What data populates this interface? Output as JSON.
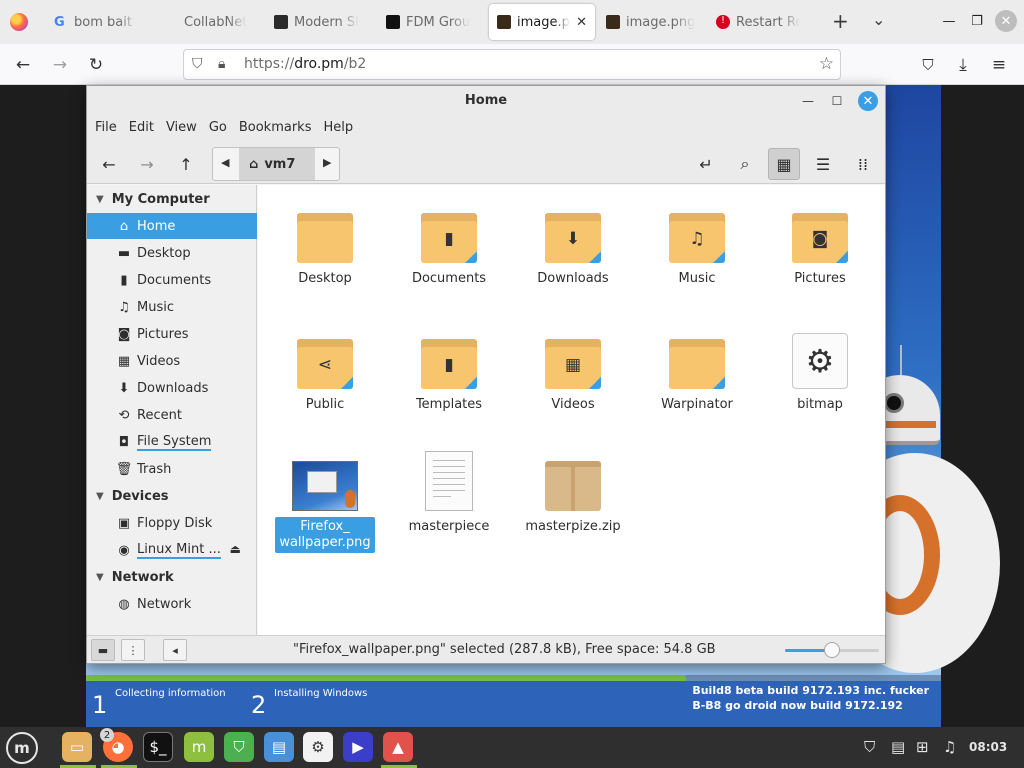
{
  "browser": {
    "tabs": [
      {
        "title": "bom bait -",
        "favicon": "google-g",
        "fav_color": "#4285f4",
        "active": false
      },
      {
        "title": "CollabNet",
        "favicon": "none",
        "fav_color": "",
        "active": false
      },
      {
        "title": "Modern Sl",
        "favicon": "site-icon",
        "fav_color": "#2b2b2b",
        "active": false
      },
      {
        "title": "FDM Grou",
        "favicon": "tiktok-icon",
        "fav_color": "#111111",
        "active": false
      },
      {
        "title": "image.pr",
        "favicon": "image-icon",
        "fav_color": "#3a2a1a",
        "active": true
      },
      {
        "title": "image.png",
        "favicon": "image-icon",
        "fav_color": "#3a2a1a",
        "active": false
      },
      {
        "title": "Restart Re",
        "favicon": "alert-icon",
        "fav_color": "#d70022",
        "active": false
      }
    ],
    "url": {
      "proto": "https://",
      "host": "dro.pm",
      "path": "/b2"
    }
  },
  "file_manager": {
    "title": "Home",
    "menu": [
      "File",
      "Edit",
      "View",
      "Go",
      "Bookmarks",
      "Help"
    ],
    "path_crumb": "vm7",
    "sidebar": {
      "my_computer": "My Computer",
      "items": [
        {
          "label": "Home",
          "icon": "home-icon",
          "glyph": "⌂"
        },
        {
          "label": "Desktop",
          "icon": "desktop-icon",
          "glyph": "▬"
        },
        {
          "label": "Documents",
          "icon": "document-icon",
          "glyph": "▮"
        },
        {
          "label": "Music",
          "icon": "music-icon",
          "glyph": "♫"
        },
        {
          "label": "Pictures",
          "icon": "camera-icon",
          "glyph": "◙"
        },
        {
          "label": "Videos",
          "icon": "film-icon",
          "glyph": "▦"
        },
        {
          "label": "Downloads",
          "icon": "download-icon",
          "glyph": "⬇"
        },
        {
          "label": "Recent",
          "icon": "recent-icon",
          "glyph": "⟲"
        },
        {
          "label": "File System",
          "icon": "drive-icon",
          "glyph": "◘"
        },
        {
          "label": "Trash",
          "icon": "trash-icon",
          "glyph": "🗑"
        }
      ],
      "devices": "Devices",
      "device_items": [
        {
          "label": "Floppy Disk",
          "icon": "floppy-icon",
          "glyph": "▣"
        },
        {
          "label": "Linux Mint ...",
          "icon": "disc-icon",
          "glyph": "◉"
        }
      ],
      "network": "Network",
      "network_items": [
        {
          "label": "Network",
          "icon": "globe-icon",
          "glyph": "◍"
        }
      ]
    },
    "files": [
      {
        "name": "Desktop",
        "kind": "folder",
        "symbol": ""
      },
      {
        "name": "Documents",
        "kind": "folder",
        "symbol": "▮"
      },
      {
        "name": "Downloads",
        "kind": "folder",
        "symbol": "⬇"
      },
      {
        "name": "Music",
        "kind": "folder",
        "symbol": "♫"
      },
      {
        "name": "Pictures",
        "kind": "folder",
        "symbol": "◙"
      },
      {
        "name": "Public",
        "kind": "folder",
        "symbol": "⋖"
      },
      {
        "name": "Templates",
        "kind": "folder",
        "symbol": "▮"
      },
      {
        "name": "Videos",
        "kind": "folder",
        "symbol": "▦"
      },
      {
        "name": "Warpinator",
        "kind": "folder",
        "symbol": ""
      },
      {
        "name": "bitmap",
        "kind": "executable",
        "symbol": "⚙"
      },
      {
        "name": "Firefox_\nwallpaper.png",
        "kind": "image",
        "symbol": ""
      },
      {
        "name": "masterpiece",
        "kind": "document",
        "symbol": ""
      },
      {
        "name": "masterpize.zip",
        "kind": "archive",
        "symbol": ""
      }
    ],
    "status": "\"Firefox_wallpaper.png\" selected (287.8 kB), Free space: 54.8 GB",
    "zoom_level": 0.5
  },
  "installer": {
    "step1_num": "1",
    "step1_label": "Collecting information",
    "step2_num": "2",
    "step2_label": "Installing Windows",
    "build_line1": "Build8 beta build 9172.193 inc. fucker",
    "build_line2": "B-B8 go droid now build 9172.192"
  },
  "taskbar": {
    "badge_count": "2",
    "clock": "08:03"
  },
  "colors": {
    "accent": "#3a9ee3",
    "folder": "#f7c56e",
    "mint_green": "#8fbf3f"
  }
}
